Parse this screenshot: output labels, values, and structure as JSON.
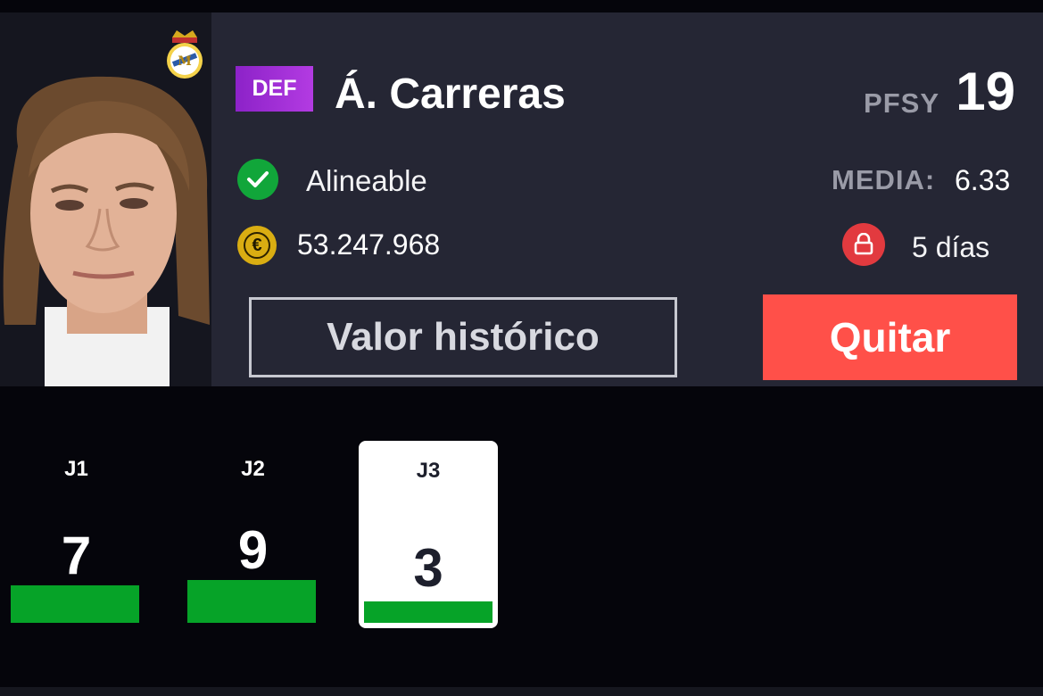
{
  "player": {
    "position": "DEF",
    "name": "Á. Carreras",
    "score_label": "PFSY",
    "score": "19",
    "status": "Alineable",
    "average_label": "MEDIA:",
    "average": "6.33",
    "value": "53.247.968",
    "lock": "5 días"
  },
  "actions": {
    "history_label": "Valor histórico",
    "remove_label": "Quitar"
  },
  "rounds": [
    {
      "label": "J1",
      "points": "7"
    },
    {
      "label": "J2",
      "points": "9"
    },
    {
      "label": "J3",
      "points": "3"
    }
  ],
  "colors": {
    "accent_purple": "#b33be2",
    "remove_red": "#ff5049",
    "status_green": "#11a63a",
    "coin_gold": "#d9ad12",
    "lock_red": "#e23a3f",
    "bar_green": "#06a328"
  },
  "icons": {
    "status": "check-icon",
    "value": "euro-coin-icon",
    "lock": "lock-icon",
    "club": "club-crest-icon"
  }
}
